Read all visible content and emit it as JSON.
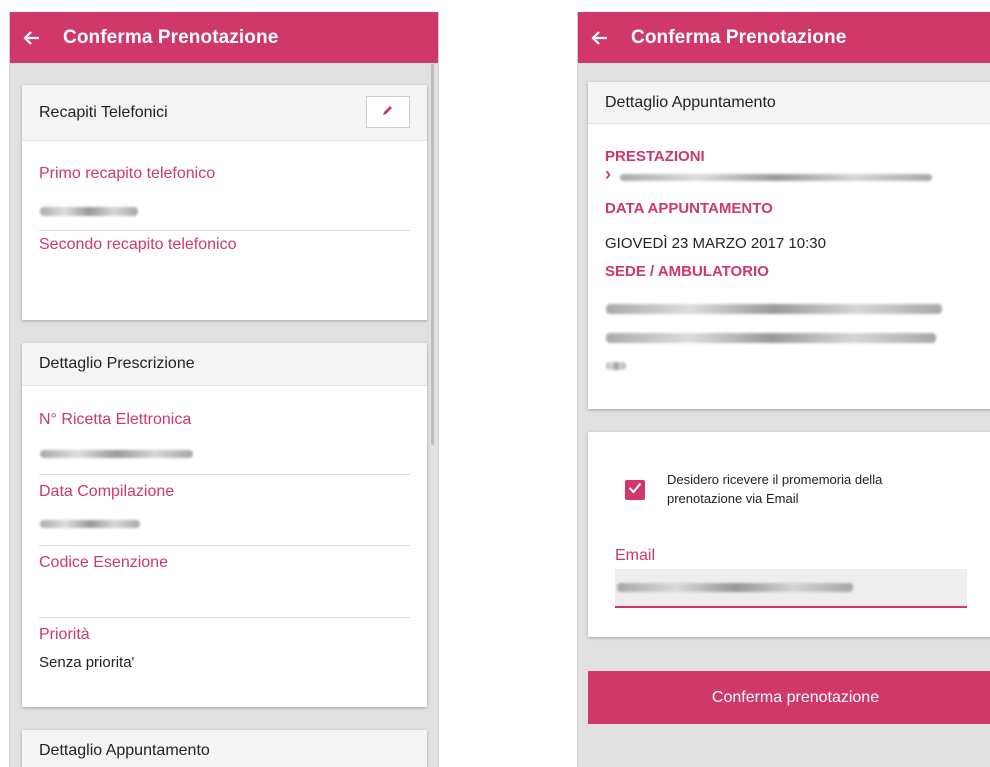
{
  "left": {
    "appbar": {
      "title": "Conferma Prenotazione"
    },
    "recapiti": {
      "title": "Recapiti Telefonici",
      "primo_label": "Primo recapito telefonico",
      "secondo_label": "Secondo recapito telefonico"
    },
    "prescrizione": {
      "title": "Dettaglio Prescrizione",
      "ricetta_label": "N° Ricetta Elettronica",
      "data_label": "Data Compilazione",
      "esenzione_label": "Codice Esenzione",
      "priorita_label": "Priorità",
      "priorita_value": "Senza priorita'"
    },
    "appuntamento": {
      "title": "Dettaglio Appuntamento"
    }
  },
  "right": {
    "appbar": {
      "title": "Conferma Prenotazione"
    },
    "appuntamento": {
      "title": "Dettaglio Appuntamento",
      "prestazioni_label": "PRESTAZIONI",
      "prestazioni_prefix": "›",
      "data_label": "DATA APPUNTAMENTO",
      "data_value": "GIOVEDÌ 23 MARZO 2017 10:30",
      "sede_label": "SEDE / AMBULATORIO"
    },
    "promemoria": {
      "checkbox_checked": true,
      "text": "Desidero ricevere il promemoria della prenotazione via Email",
      "email_label": "Email"
    },
    "confirm_label": "Conferma prenotazione"
  },
  "colors": {
    "accent": "#cf3868",
    "background": "#e1e1e1"
  },
  "icons": [
    "back-arrow-icon",
    "pencil-icon",
    "checkmark-icon"
  ]
}
